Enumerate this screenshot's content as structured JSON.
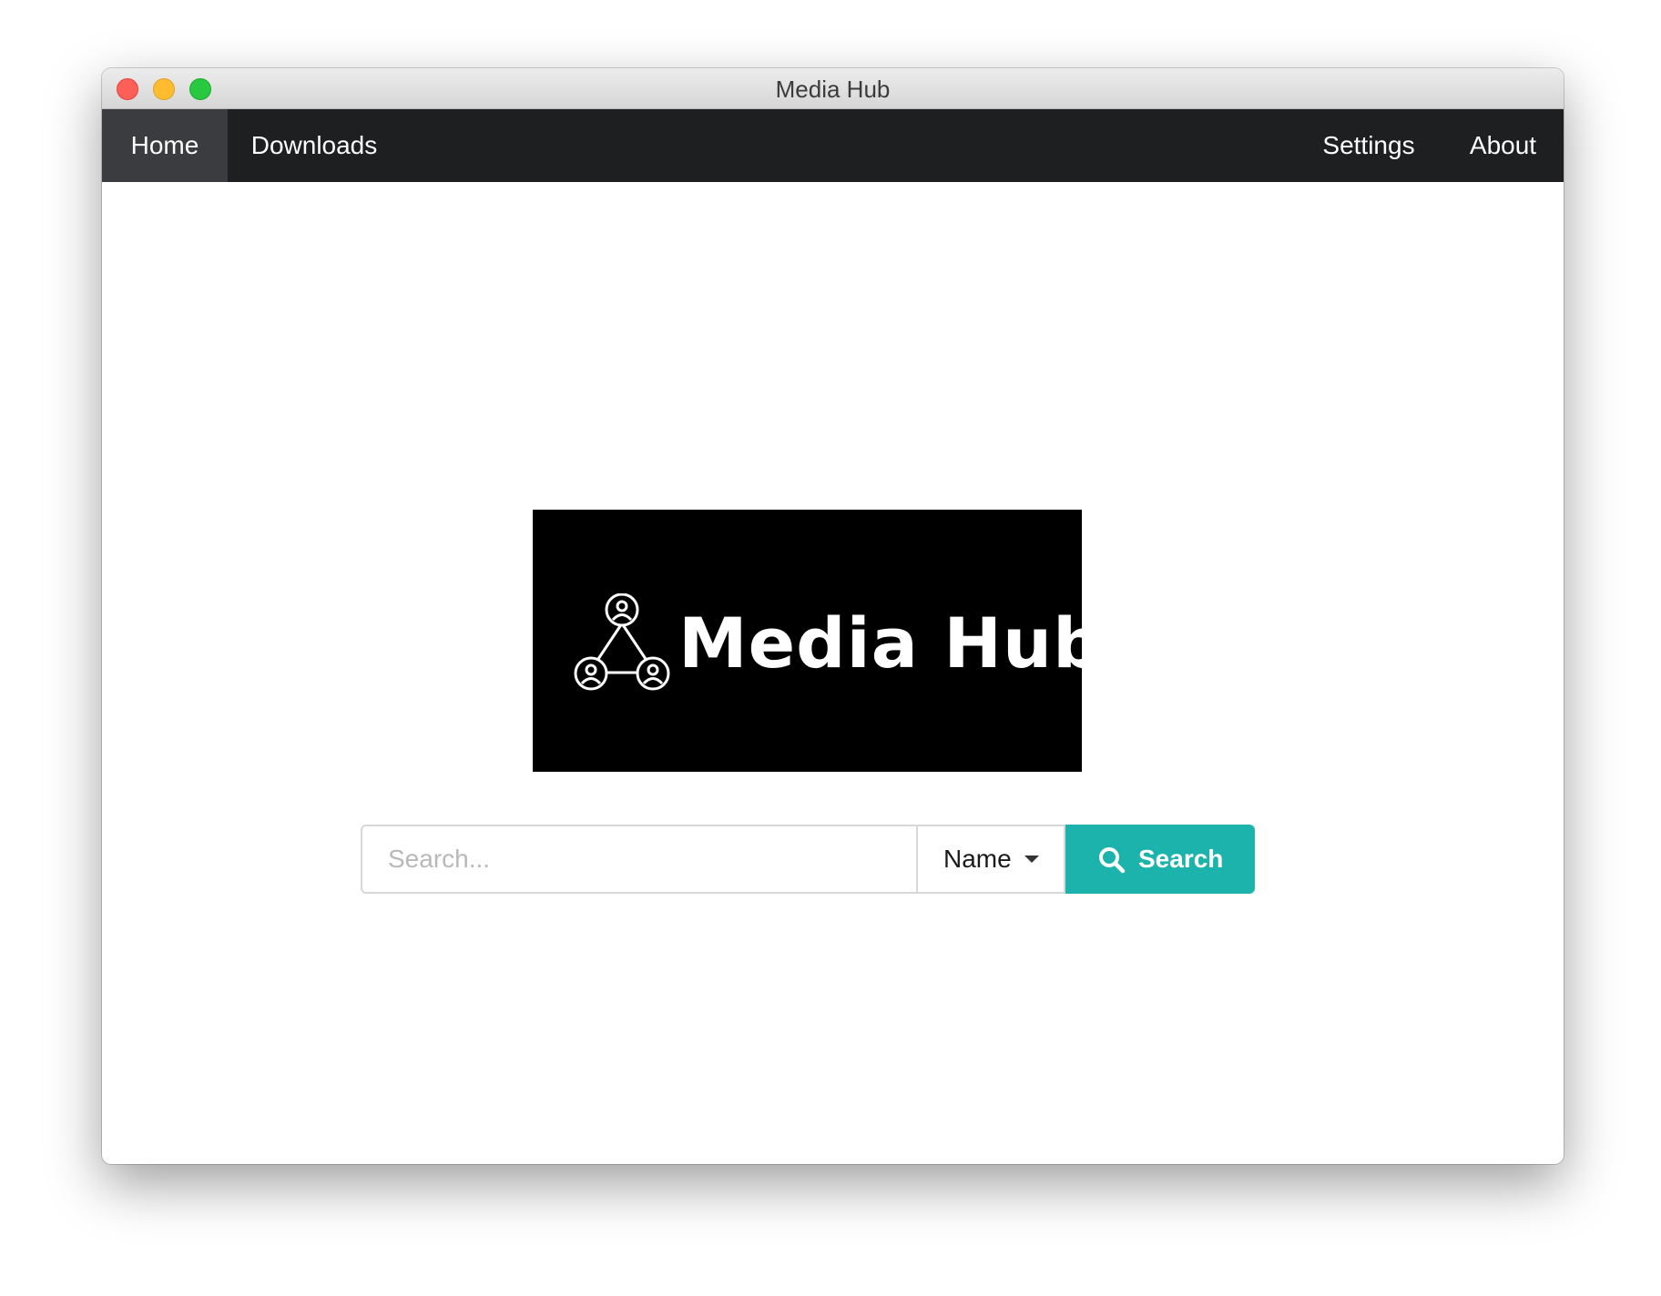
{
  "window": {
    "title": "Media Hub"
  },
  "nav": {
    "left": [
      {
        "label": "Home",
        "active": true
      },
      {
        "label": "Downloads",
        "active": false
      }
    ],
    "right": [
      {
        "label": "Settings"
      },
      {
        "label": "About"
      }
    ]
  },
  "logo": {
    "text": "Media Hub",
    "icon": "network-people-icon",
    "background": "#000000"
  },
  "search": {
    "placeholder": "Search...",
    "value": "",
    "field_selected": "Name",
    "button_label": "Search",
    "button_icon": "search-icon",
    "button_color": "#1cb3ad"
  },
  "colors": {
    "navbar": "#1e1f21",
    "nav_active": "#3b3c3f",
    "accent": "#1cb3ad"
  }
}
